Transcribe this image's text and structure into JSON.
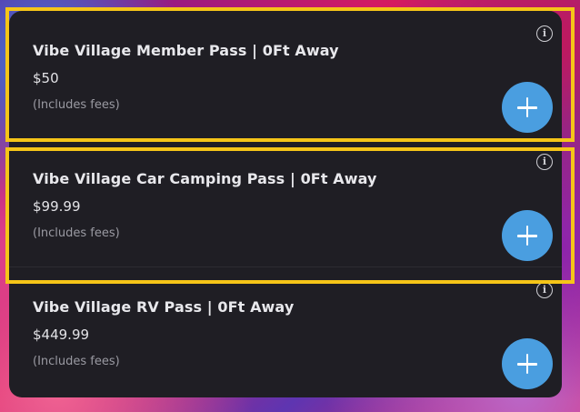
{
  "passes": [
    {
      "title": "Vibe Village Member Pass | 0Ft Away",
      "price": "$50",
      "fees_note": "(Includes fees)",
      "info_icon": "i",
      "add_icon": "plus-icon"
    },
    {
      "title": "Vibe Village Car Camping Pass | 0Ft Away",
      "price": "$99.99",
      "fees_note": "(Includes fees)",
      "info_icon": "i",
      "add_icon": "plus-icon"
    },
    {
      "title": "Vibe Village RV Pass | 0Ft Away",
      "price": "$449.99",
      "fees_note": "(Includes fees)",
      "info_icon": "i",
      "add_icon": "plus-icon"
    }
  ],
  "colors": {
    "card_background": "#1f1e24",
    "add_button": "#4a9ee0",
    "highlight_outline": "#f5c518",
    "fees_text": "#9a9aa2"
  }
}
